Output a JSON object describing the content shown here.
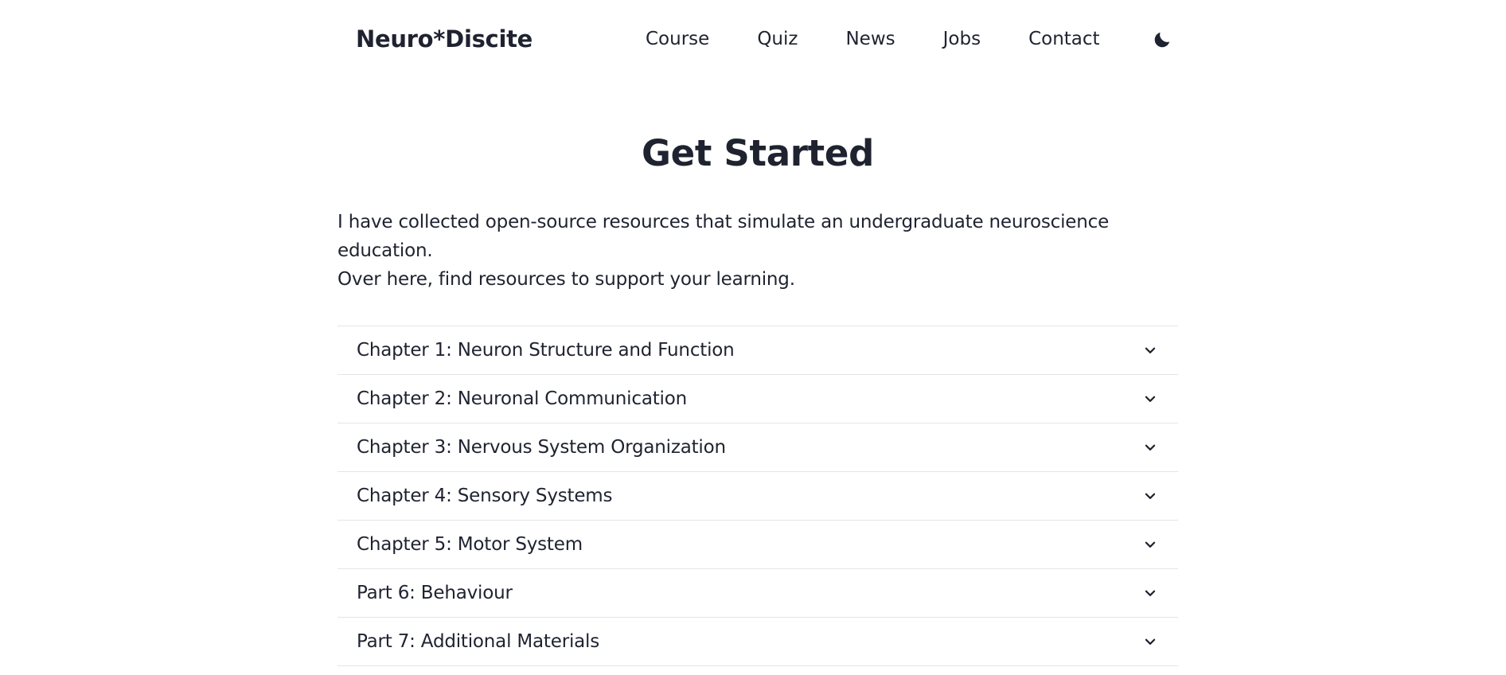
{
  "header": {
    "brand": "Neuro*Discite",
    "nav": [
      {
        "label": "Course"
      },
      {
        "label": "Quiz"
      },
      {
        "label": "News"
      },
      {
        "label": "Jobs"
      },
      {
        "label": "Contact"
      }
    ],
    "theme_toggle_icon": "moon-icon"
  },
  "main": {
    "title": "Get Started",
    "intro_line1": "I have collected open-source resources that simulate an undergraduate neuroscience education.",
    "intro_line2": "Over here, find resources to support your learning.",
    "accordion": [
      {
        "label": "Chapter 1: Neuron Structure and Function",
        "icon": "chevron-down-icon"
      },
      {
        "label": "Chapter 2: Neuronal Communication",
        "icon": "chevron-down-icon"
      },
      {
        "label": "Chapter 3: Nervous System Organization",
        "icon": "chevron-down-icon"
      },
      {
        "label": "Chapter 4: Sensory Systems",
        "icon": "chevron-down-icon"
      },
      {
        "label": "Chapter 5: Motor System",
        "icon": "chevron-down-icon"
      },
      {
        "label": "Part 6: Behaviour",
        "icon": "chevron-down-icon"
      },
      {
        "label": "Part 7: Additional Materials",
        "icon": "chevron-down-icon"
      }
    ]
  },
  "colors": {
    "text": "#1f2330",
    "divider": "#e3e5e8",
    "background": "#ffffff"
  }
}
